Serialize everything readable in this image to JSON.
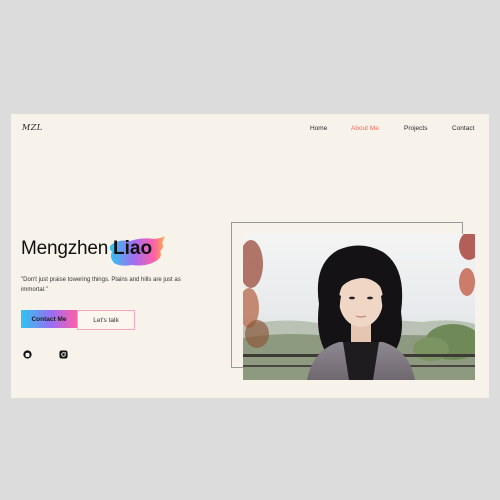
{
  "header": {
    "logo": "MZL",
    "nav": [
      {
        "label": "Home",
        "active": false
      },
      {
        "label": "About Me",
        "active": true
      },
      {
        "label": "Projects",
        "active": false
      },
      {
        "label": "Contact",
        "active": false
      }
    ]
  },
  "hero": {
    "first_name": "Mengzhen",
    "last_name": "Liao",
    "quote": "\"Don't just praise towering things. Plains and hills are just as immortal.\"",
    "primary_button": "Contact Me",
    "secondary_button": "Let's talk"
  },
  "social": [
    {
      "icon": "github-icon"
    },
    {
      "icon": "instagram-icon"
    }
  ],
  "photo": {
    "subject": "portrait-photo"
  },
  "colors": {
    "background": "#f8f3ea",
    "accent": "#f26d5b",
    "gradient_start": "#2ec5f0",
    "gradient_end": "#ff5fa8"
  }
}
